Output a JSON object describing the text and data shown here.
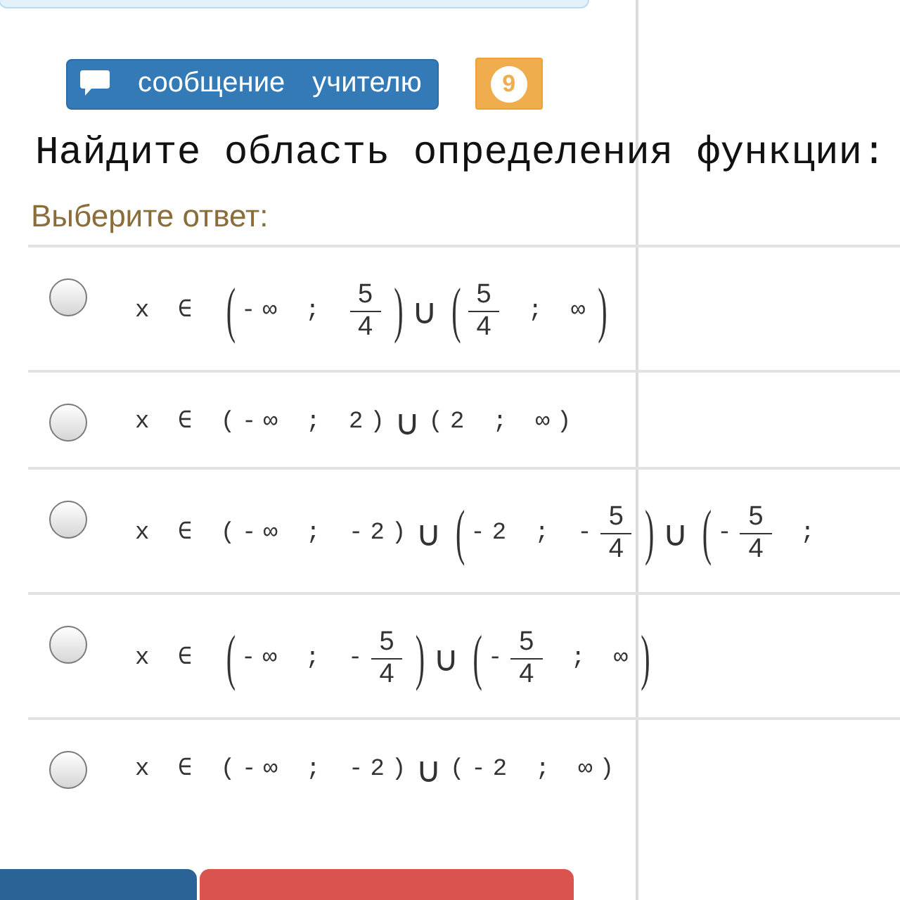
{
  "message_button": {
    "label": "сообщение учителю"
  },
  "counter": {
    "count": "9"
  },
  "question": "Найдите область определения функции:",
  "prompt": "Выберите ответ:",
  "options": [
    {
      "selected": false,
      "parts": [
        {
          "kind": "text",
          "text": "x ∈ "
        },
        {
          "kind": "paren",
          "text": "("
        },
        {
          "kind": "text",
          "text": "-∞ ; "
        },
        {
          "kind": "frac",
          "num": "5",
          "den": "4"
        },
        {
          "kind": "paren",
          "text": ")"
        },
        {
          "kind": "union",
          "text": "∪"
        },
        {
          "kind": "paren",
          "text": "("
        },
        {
          "kind": "frac",
          "num": "5",
          "den": "4"
        },
        {
          "kind": "text",
          "text": " ; ∞"
        },
        {
          "kind": "paren",
          "text": ")"
        }
      ]
    },
    {
      "selected": false,
      "parts": [
        {
          "kind": "text",
          "text": "x ∈ (-∞ ; 2)"
        },
        {
          "kind": "union",
          "text": "∪"
        },
        {
          "kind": "text",
          "text": "(2 ; ∞)"
        }
      ]
    },
    {
      "selected": false,
      "parts": [
        {
          "kind": "text",
          "text": "x ∈ (-∞ ; -2)"
        },
        {
          "kind": "union",
          "text": "∪"
        },
        {
          "kind": "paren",
          "text": "("
        },
        {
          "kind": "text",
          "text": "-2 ; -"
        },
        {
          "kind": "frac",
          "num": "5",
          "den": "4"
        },
        {
          "kind": "paren",
          "text": ")"
        },
        {
          "kind": "union",
          "text": "∪"
        },
        {
          "kind": "paren",
          "text": "("
        },
        {
          "kind": "text",
          "text": "-"
        },
        {
          "kind": "frac",
          "num": "5",
          "den": "4"
        },
        {
          "kind": "text",
          "text": " ;"
        }
      ]
    },
    {
      "selected": false,
      "parts": [
        {
          "kind": "text",
          "text": "x ∈ "
        },
        {
          "kind": "paren",
          "text": "("
        },
        {
          "kind": "text",
          "text": "-∞ ; -"
        },
        {
          "kind": "frac",
          "num": "5",
          "den": "4"
        },
        {
          "kind": "paren",
          "text": ")"
        },
        {
          "kind": "union",
          "text": "∪"
        },
        {
          "kind": "paren",
          "text": "("
        },
        {
          "kind": "text",
          "text": "-"
        },
        {
          "kind": "frac",
          "num": "5",
          "den": "4"
        },
        {
          "kind": "text",
          "text": " ; ∞"
        },
        {
          "kind": "paren",
          "text": ")"
        }
      ]
    },
    {
      "selected": false,
      "parts": [
        {
          "kind": "text",
          "text": "x ∈ (-∞ ; -2)"
        },
        {
          "kind": "union",
          "text": "∪"
        },
        {
          "kind": "text",
          "text": "(-2 ; ∞)"
        }
      ]
    }
  ],
  "footer_buttons": [
    {
      "kind": "primary"
    },
    {
      "kind": "danger"
    }
  ]
}
